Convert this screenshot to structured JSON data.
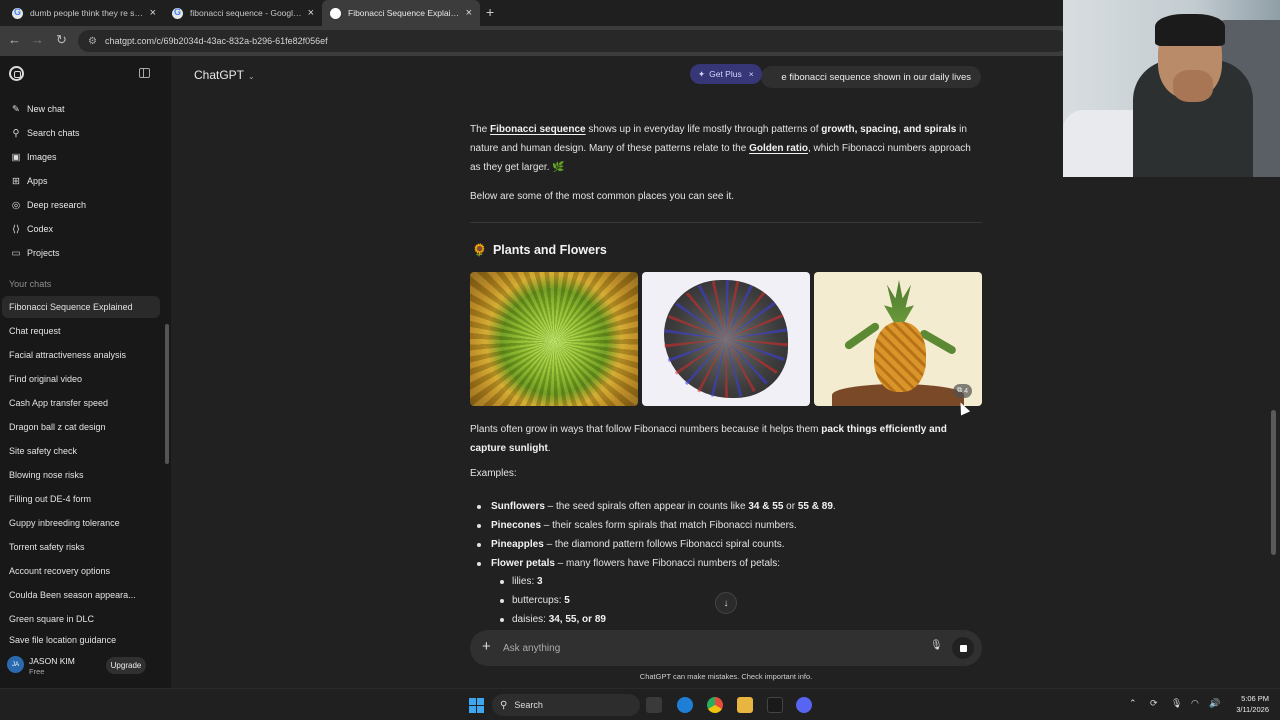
{
  "browser": {
    "tabs": [
      {
        "title": "dumb people think they re sma",
        "icon": "google-icon"
      },
      {
        "title": "fibonacci sequence - Google Se",
        "icon": "google-icon"
      },
      {
        "title": "Fibonacci Sequence Explained",
        "icon": "chatgpt-icon"
      }
    ],
    "url": "chatgpt.com/c/69b2034d-43ac-832a-b296-61fe82f056ef"
  },
  "sidebar": {
    "nav": [
      {
        "label": "New chat",
        "icon": "edit-icon"
      },
      {
        "label": "Search chats",
        "icon": "search-icon"
      },
      {
        "label": "Images",
        "icon": "image-icon"
      },
      {
        "label": "Apps",
        "icon": "apps-icon"
      },
      {
        "label": "Deep research",
        "icon": "telescope-icon"
      },
      {
        "label": "Codex",
        "icon": "code-icon"
      },
      {
        "label": "Projects",
        "icon": "folder-icon"
      }
    ],
    "section_label": "Your chats",
    "chats": [
      "Fibonacci Sequence Explained",
      "Chat request",
      "Facial attractiveness analysis",
      "Find original video",
      "Cash App transfer speed",
      "Dragon ball z cat design",
      "Site safety check",
      "Blowing nose risks",
      "Filling out DE-4 form",
      "Guppy inbreeding tolerance",
      "Torrent safety risks",
      "Account recovery options",
      "Coulda Been season appeara...",
      "Green square in DLC",
      "Save file location guidance"
    ],
    "user": {
      "initials": "JA",
      "name": "JASON KIM",
      "plan": "Free",
      "upgrade": "Upgrade"
    }
  },
  "header": {
    "model": "ChatGPT",
    "get_plus": "Get Plus",
    "user_message": "e fibonacci sequence shown in our daily lives"
  },
  "answer": {
    "intro_p1": {
      "t1": "The ",
      "link1": "Fibonacci sequence",
      "t2": " shows up in everyday life mostly through patterns of ",
      "b1": "growth, spacing, and spirals",
      "t3": " in nature and human design. Many of these patterns relate to the ",
      "link2": "Golden ratio",
      "t4": ", which Fibonacci numbers approach as they get larger. 🌿"
    },
    "intro_p2": "Below are some of the most common places you can see it.",
    "section_emoji": "🌻",
    "section_title": "Plants and Flowers",
    "image_count": "4",
    "plants_p": {
      "t1": "Plants often grow in ways that follow Fibonacci numbers because it helps them ",
      "b1": "pack things efficiently and capture sunlight",
      "t2": "."
    },
    "examples_label": "Examples:",
    "examples": [
      {
        "term": "Sunflowers",
        "text": " – the seed spirals often appear in counts like ",
        "b1": "34 & 55",
        "t2": " or ",
        "b2": "55 & 89",
        "t3": "."
      },
      {
        "term": "Pinecones",
        "text": " – their scales form spirals that match Fibonacci numbers.",
        "b1": "",
        "t2": "",
        "b2": "",
        "t3": ""
      },
      {
        "term": "Pineapples",
        "text": " – the diamond pattern follows Fibonacci spiral counts.",
        "b1": "",
        "t2": "",
        "b2": "",
        "t3": ""
      },
      {
        "term": "Flower petals",
        "text": " – many flowers have Fibonacci numbers of petals:",
        "b1": "",
        "t2": "",
        "b2": "",
        "t3": ""
      }
    ],
    "petals": [
      {
        "label": "lilies: ",
        "value": "3"
      },
      {
        "label": "buttercups: ",
        "value": "5"
      },
      {
        "label": "daisies: ",
        "value": "34, 55, or 89"
      }
    ]
  },
  "composer": {
    "placeholder": "Ask anything"
  },
  "disclaimer": "ChatGPT can make mistakes. Check important info.",
  "taskbar": {
    "search": "Search",
    "time": "5:06 PM",
    "date": "3/11/2026"
  }
}
